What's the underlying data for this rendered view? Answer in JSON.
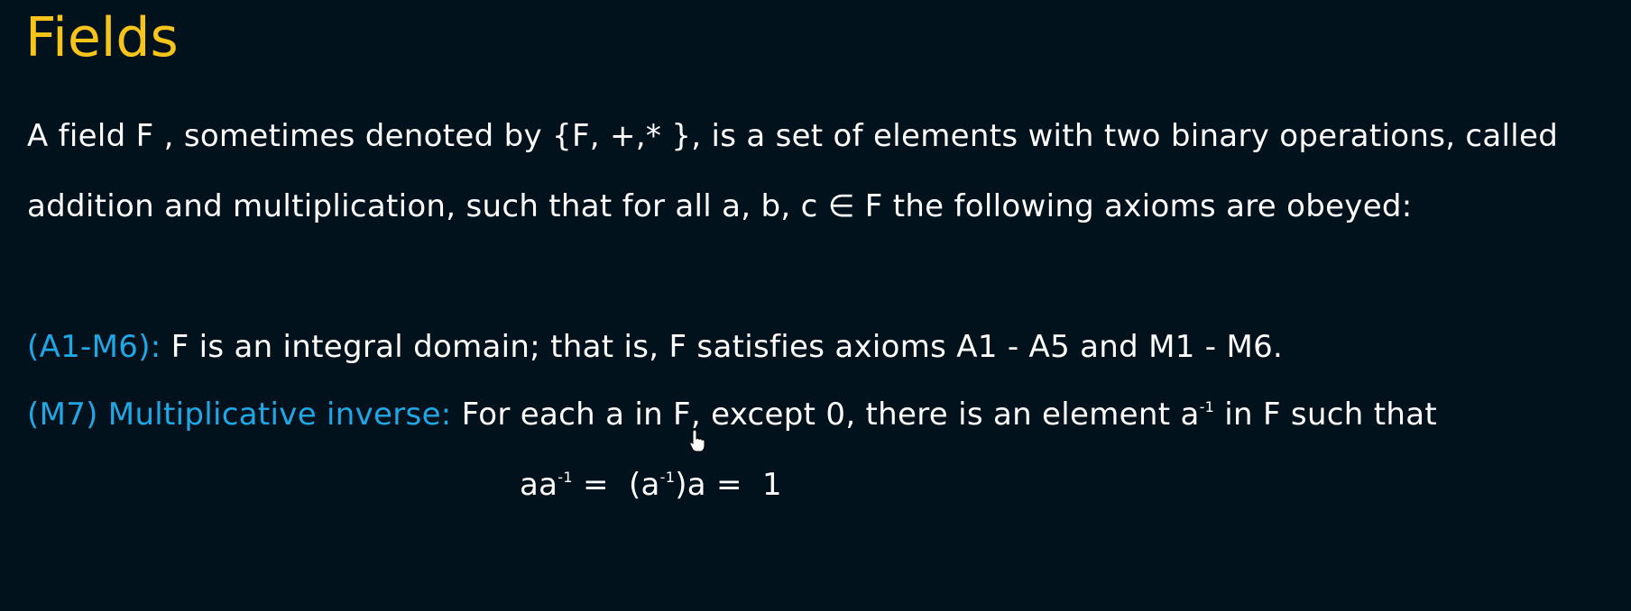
{
  "slide": {
    "title": "Fields",
    "intro": "A field F , sometimes denoted by {F, +,* }, is a set of elements with two binary operations, called addition and multiplication, such that for all a, b, c ∈ F the following axioms are obeyed:",
    "axioms": [
      {
        "label": "(A1-M6):",
        "text": " F is an integral domain; that is, F satisfies axioms A1 - A5 and M1 - M6."
      },
      {
        "label": "(M7) Multiplicative inverse:",
        "text_before": " For each a in F, except 0, there is an element a",
        "superscript": "-1",
        "text_after": " in F such that"
      }
    ],
    "equation": {
      "lhs_base": "aa",
      "lhs_sup": "-1",
      "eq1": " =  (a",
      "mid_sup": "-1",
      "mid_close": ")a =  1"
    }
  },
  "colors": {
    "background": "#02121c",
    "title": "#f7c41a",
    "accent": "#1fa7e6",
    "text": "#ffffff"
  },
  "icons": {
    "cursor": "hand-pointer-icon"
  }
}
